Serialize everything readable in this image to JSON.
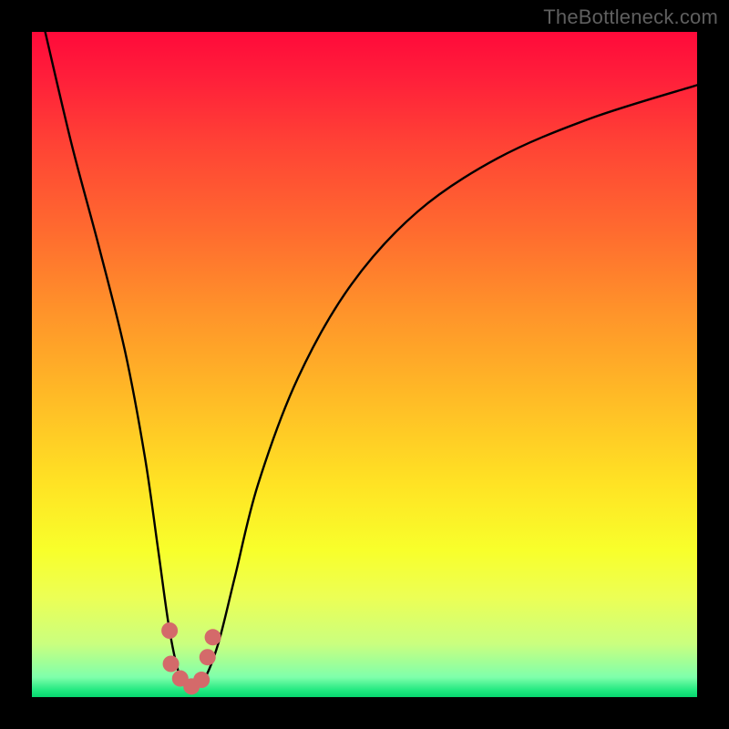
{
  "watermark": "TheBottleneck.com",
  "chart_data": {
    "type": "line",
    "title": "",
    "xlabel": "",
    "ylabel": "",
    "xlim": [
      0,
      100
    ],
    "ylim": [
      0,
      100
    ],
    "grid": false,
    "series": [
      {
        "name": "curve",
        "x": [
          2,
          6,
          10,
          14,
          17,
          19,
          20.7,
          22.3,
          24.0,
          25.8,
          28.0,
          30.5,
          34,
          40,
          48,
          58,
          70,
          84,
          100
        ],
        "values": [
          100,
          83,
          68,
          52,
          36,
          22,
          10,
          3.0,
          1.5,
          2.5,
          8.0,
          18,
          32,
          48,
          62,
          73,
          81,
          87,
          92
        ]
      }
    ],
    "markers": [
      {
        "x": 20.7,
        "y": 10.0
      },
      {
        "x": 20.9,
        "y": 5.0
      },
      {
        "x": 22.3,
        "y": 2.8
      },
      {
        "x": 24.0,
        "y": 1.6
      },
      {
        "x": 25.5,
        "y": 2.6
      },
      {
        "x": 26.4,
        "y": 6.0
      },
      {
        "x": 27.2,
        "y": 9.0
      }
    ],
    "curve_color": "#000000",
    "marker_color": "#d46a6a"
  }
}
